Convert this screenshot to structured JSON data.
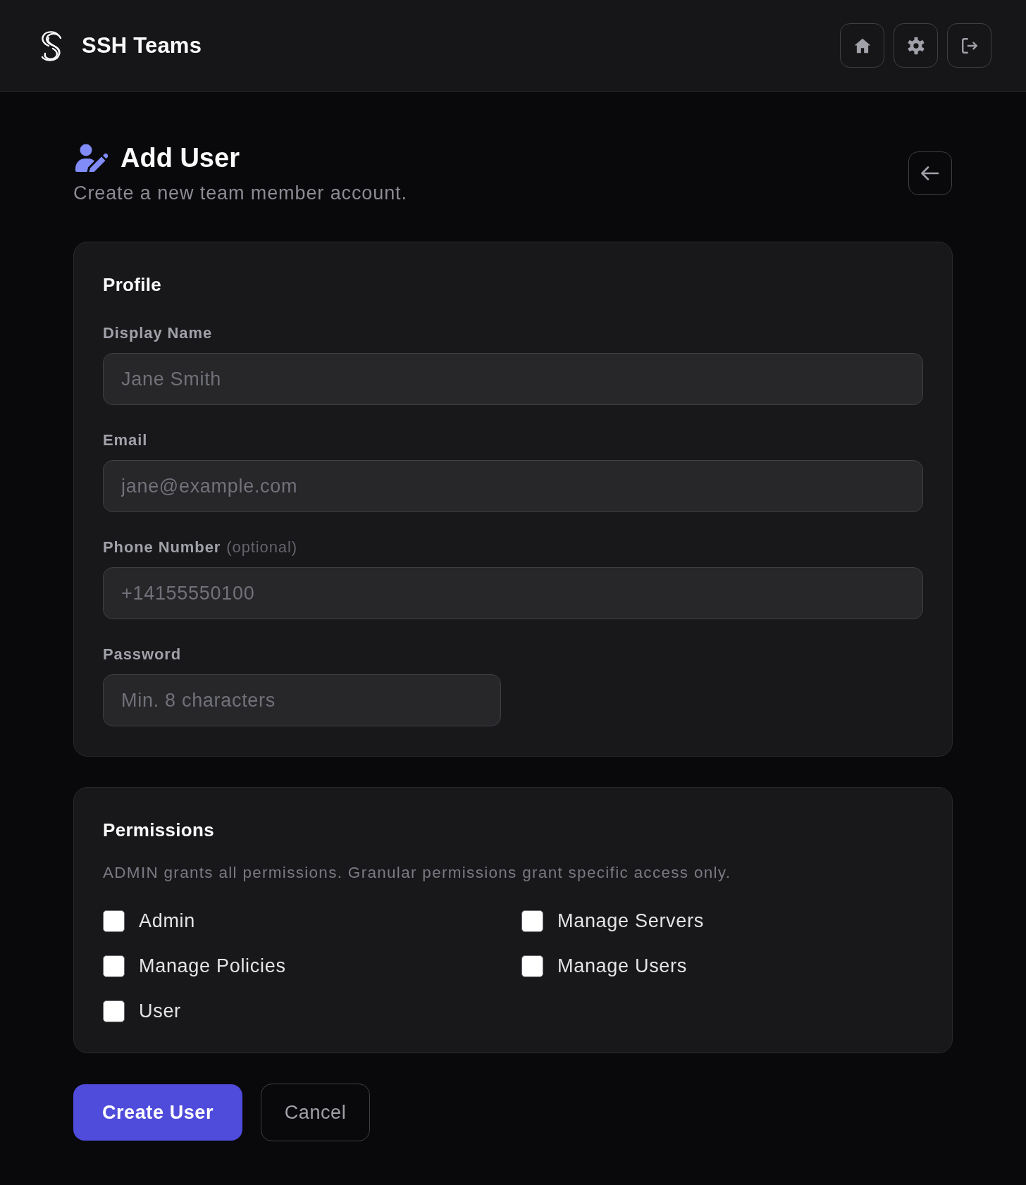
{
  "header": {
    "title": "SSH Teams"
  },
  "page": {
    "title": "Add User",
    "subtitle": "Create a new team member account."
  },
  "profile": {
    "heading": "Profile",
    "fields": [
      {
        "kind": "text",
        "label": "Display Name",
        "placeholder": "Jane Smith"
      },
      {
        "kind": "email",
        "label": "Email",
        "placeholder": "jane@example.com"
      },
      {
        "kind": "tel",
        "label": "Phone Number",
        "note": "(optional)",
        "placeholder": "+14155550100"
      },
      {
        "kind": "password",
        "label": "Password",
        "placeholder": "Min. 8 characters"
      }
    ]
  },
  "permissions": {
    "heading": "Permissions",
    "description": "ADMIN grants all permissions. Granular permissions grant specific access only.",
    "options": [
      {
        "label": "Admin",
        "checked": false
      },
      {
        "label": "Manage Servers",
        "checked": false
      },
      {
        "label": "Manage Policies",
        "checked": false
      },
      {
        "label": "Manage Users",
        "checked": false
      },
      {
        "label": "User",
        "checked": false
      }
    ]
  },
  "actions": [
    {
      "kind": "primary",
      "label": "Create User"
    },
    {
      "kind": "secondary",
      "label": "Cancel"
    }
  ]
}
